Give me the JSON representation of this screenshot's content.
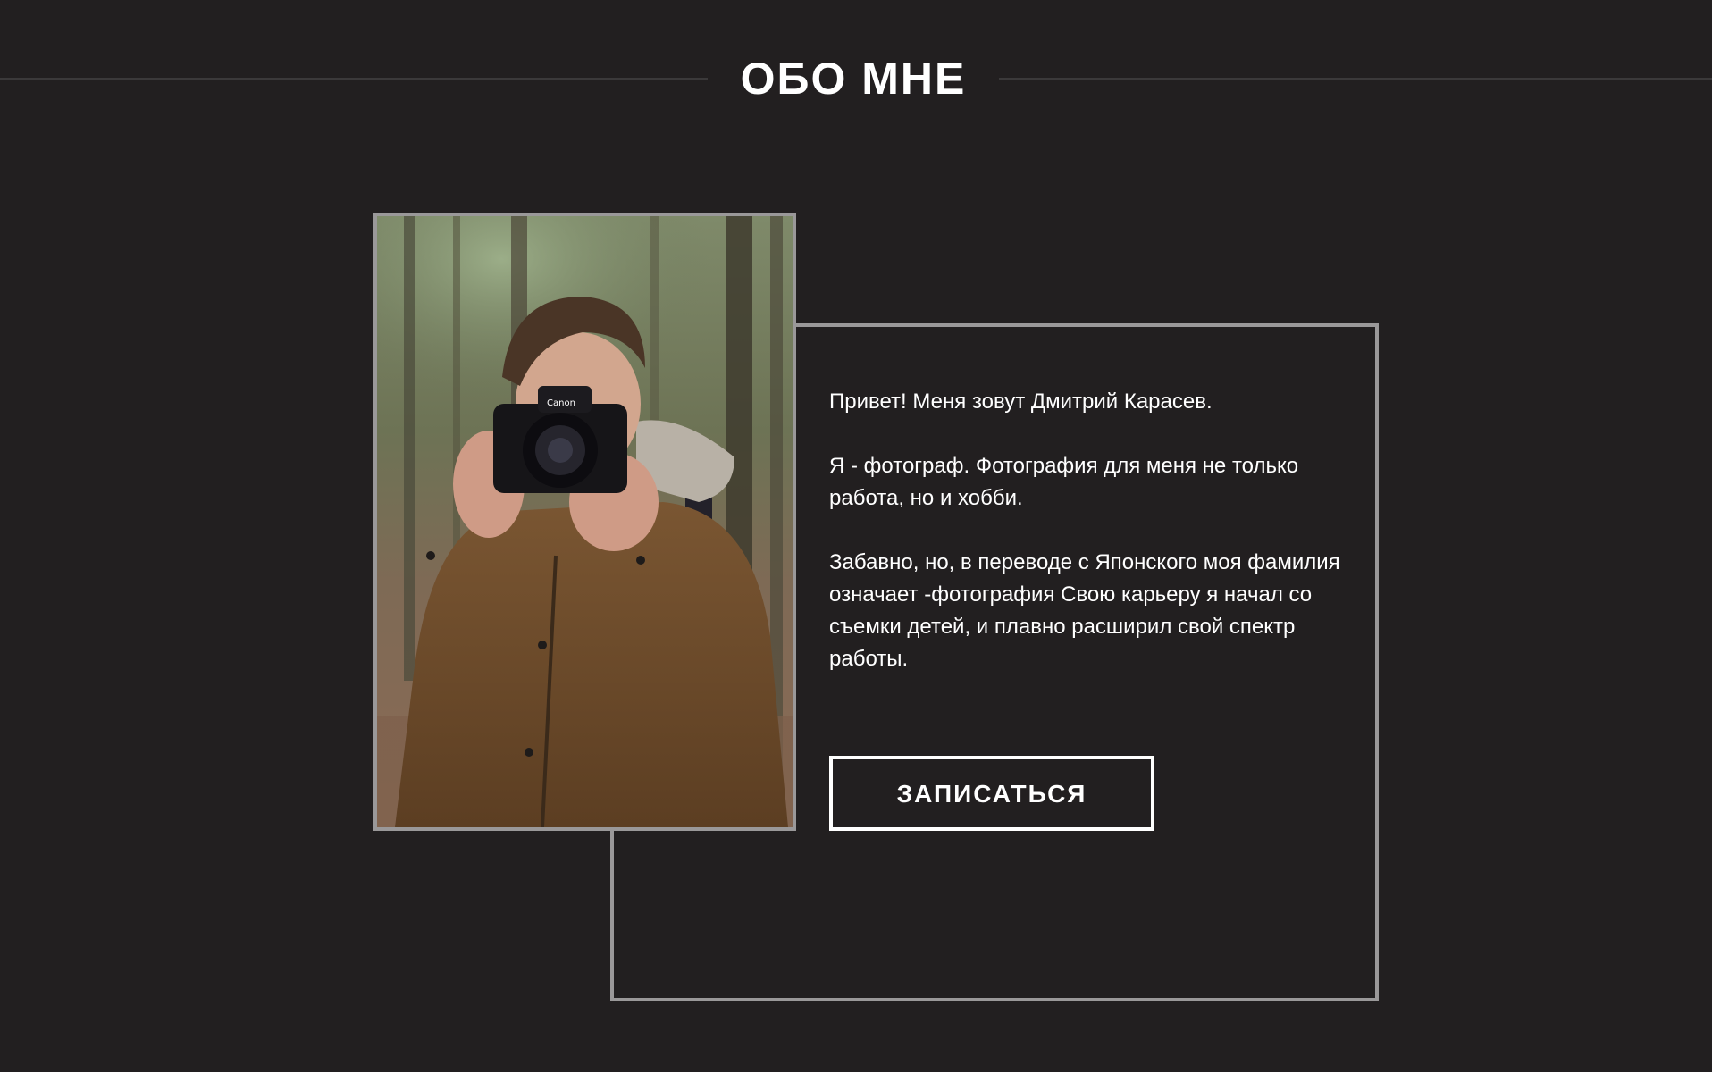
{
  "header": {
    "title": "ОБО МНЕ"
  },
  "photo": {
    "icon": "photographer-photo"
  },
  "about": {
    "paragraphs": [
      "Привет! Меня зовут Дмитрий Карасев.",
      "Я - фотограф. Фотография для меня не только работа, но и хобби.",
      "Забавно, но, в переводе с Японского моя фамилия означает -фотография Свою карьеру я начал со съемки детей, и плавно расширил свой спектр работы."
    ]
  },
  "button": {
    "label": "ЗАПИСАТЬСЯ"
  },
  "colors": {
    "background": "#221f20",
    "frame": "#9a9899",
    "text": "#ffffff",
    "rule": "#3b393a"
  }
}
